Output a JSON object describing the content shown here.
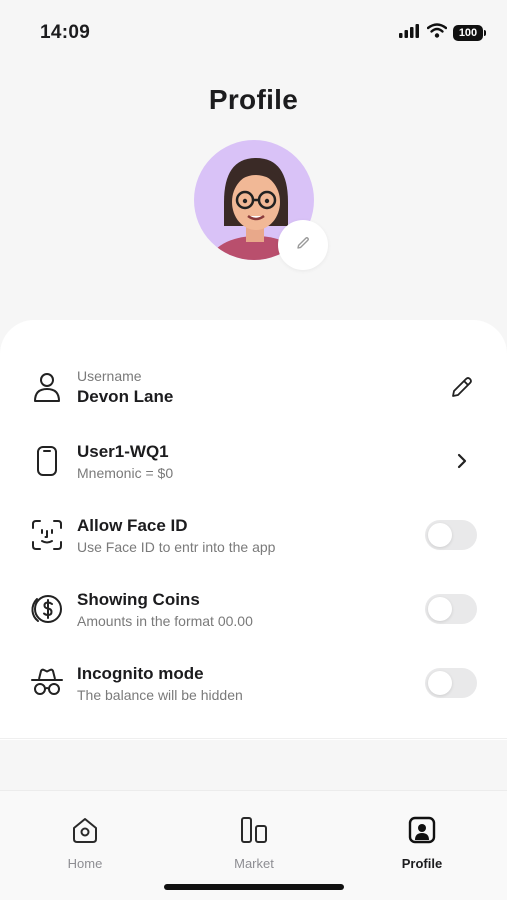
{
  "status_bar": {
    "time": "14:09",
    "battery": "100",
    "icons": [
      "signal-icon",
      "wifi-icon",
      "battery-icon"
    ]
  },
  "page": {
    "title": "Profile"
  },
  "avatar": {
    "edit_icon": "pencil-icon",
    "background": "#d9c2f7"
  },
  "settings": {
    "username": {
      "label": "Username",
      "value": "Devon Lane",
      "icon": "user-icon",
      "action_icon": "pencil-icon"
    },
    "wallet": {
      "title": "User1-WQ1",
      "subtitle": "Mnemonic = $0",
      "icon": "phone-icon",
      "action_icon": "chevron-right-icon"
    },
    "face_id": {
      "title": "Allow Face ID",
      "subtitle": "Use Face ID to entr into the app",
      "icon": "face-id-icon",
      "enabled": false
    },
    "coins": {
      "title": "Showing Coins",
      "subtitle": "Amounts in the format 00.00",
      "icon": "dollar-coins-icon",
      "enabled": false
    },
    "incognito": {
      "title": "Incognito mode",
      "subtitle": "The balance will be hidden",
      "icon": "incognito-icon",
      "enabled": false
    }
  },
  "tabs": [
    {
      "label": "Home",
      "icon": "home-icon",
      "active": false
    },
    {
      "label": "Market",
      "icon": "market-icon",
      "active": false
    },
    {
      "label": "Profile",
      "icon": "profile-icon",
      "active": true
    }
  ],
  "colors": {
    "background": "#f6f6f6",
    "card": "#ffffff",
    "text": "#1c1c1e",
    "muted": "#7a7a7a",
    "toggle_off": "#e9e9ea"
  }
}
